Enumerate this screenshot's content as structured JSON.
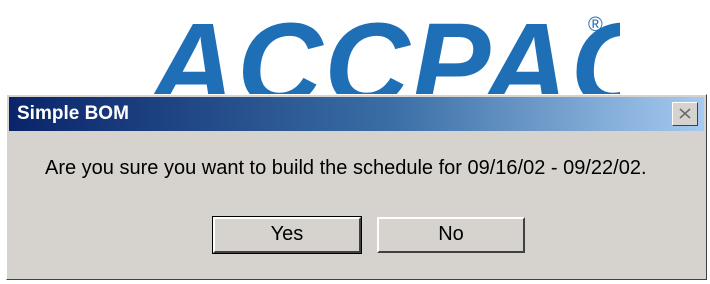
{
  "background": {
    "logo_text": "ACCPAC",
    "logo_mark": "®",
    "brand_color": "#1f6fb7"
  },
  "dialog": {
    "title": "Simple BOM",
    "close_icon": "close-icon",
    "message": "Are you sure you want to build the schedule for 09/16/02 - 09/22/02.",
    "buttons": {
      "yes_label": "Yes",
      "no_label": "No"
    },
    "colors": {
      "titlebar_start": "#0a246a",
      "titlebar_end": "#a6caf0",
      "face": "#d6d3ce"
    }
  }
}
